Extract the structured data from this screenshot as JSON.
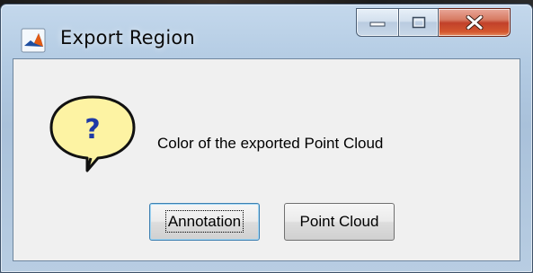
{
  "window": {
    "title": "Export Region",
    "app_icon": "matlab-logo-icon",
    "caption_buttons": [
      "minimize-icon",
      "maximize-icon",
      "close-icon"
    ]
  },
  "dialog": {
    "icon": "question-icon",
    "message": "Color of the exported Point Cloud",
    "buttons": {
      "annotation": "Annotation",
      "point_cloud": "Point Cloud"
    },
    "default_button": "Annotation"
  },
  "colors": {
    "close_button": "#c1412a",
    "question_bubble": "#fdf3a3",
    "question_mark": "#1f3aa6"
  }
}
